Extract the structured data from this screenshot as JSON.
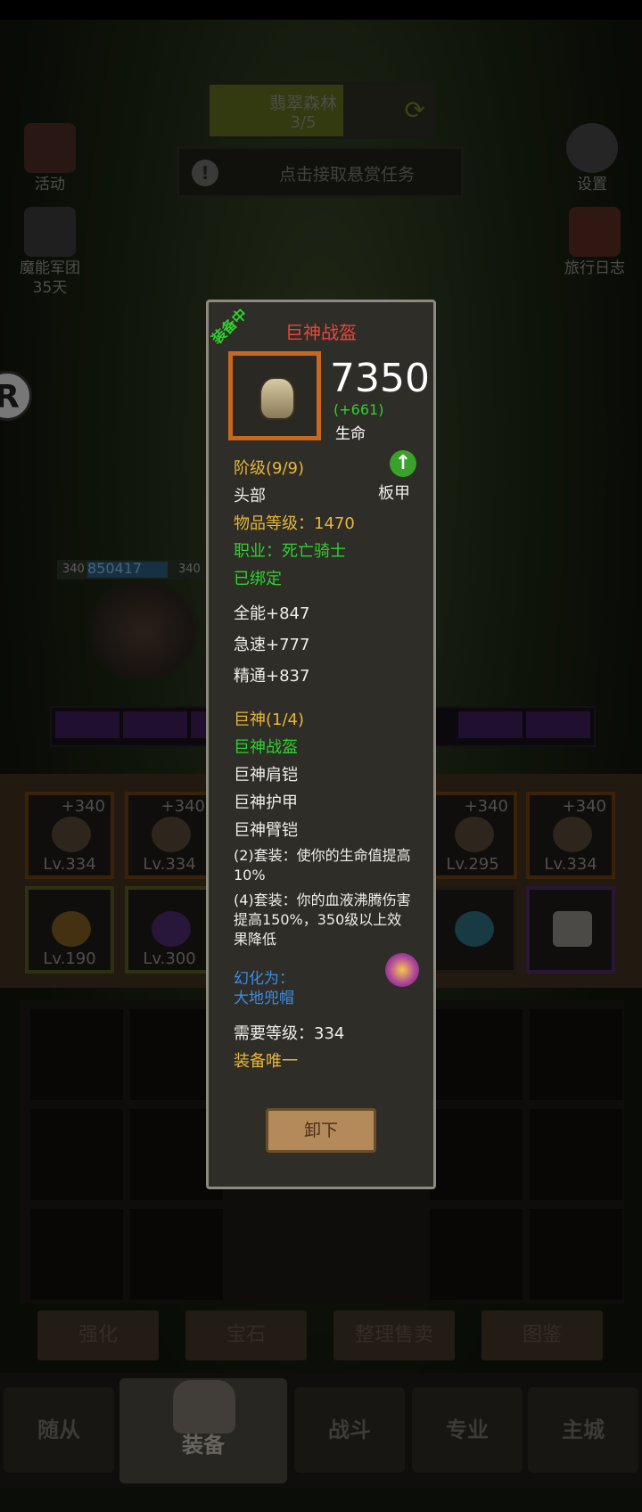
{
  "hud": {
    "stage_name": "翡翠森林",
    "stage_progress": "3/5",
    "bounty_text": "点击接取悬赏任务",
    "left_icons": [
      {
        "label": "活动"
      },
      {
        "label": "魔能军团",
        "sub": "35天"
      }
    ],
    "right_icons": [
      {
        "label": "设置"
      },
      {
        "label": "旅行日志"
      }
    ]
  },
  "battle": {
    "hero_level_left": "340",
    "hero_power": "850417",
    "hero_level_right": "340"
  },
  "equip_slots_top": [
    {
      "plus": "+340",
      "level": "Lv.334"
    },
    {
      "plus": "+340",
      "level": "Lv.334"
    },
    {
      "plus": "+340",
      "level": "Lv.295"
    },
    {
      "plus": "+340",
      "level": "Lv.334"
    }
  ],
  "equip_slots_bottom": [
    {
      "level": "Lv.190"
    },
    {
      "level": "Lv.300"
    }
  ],
  "sub_buttons": [
    "强化",
    "宝石",
    "整理售卖",
    "图鉴"
  ],
  "bottom_nav": [
    "随从",
    "装备",
    "战斗",
    "专业",
    "主城"
  ],
  "tooltip": {
    "equipped_tag": "装备中",
    "item_name": "巨神战盔",
    "main_stat_value": "7350",
    "main_stat_delta": "(+661)",
    "main_stat_name": "生命",
    "tier": "阶级(9/9)",
    "slot": "头部",
    "armor_type": "板甲",
    "item_level": "物品等级：1470",
    "class_req": "职业：死亡骑士",
    "bound": "已绑定",
    "stats": [
      "全能+847",
      "急速+777",
      "精通+837"
    ],
    "set_name": "巨神(1/4)",
    "set_pieces": [
      {
        "name": "巨神战盔",
        "owned": true
      },
      {
        "name": "巨神肩铠",
        "owned": false
      },
      {
        "name": "巨神护甲",
        "owned": false
      },
      {
        "name": "巨神臂铠",
        "owned": false
      }
    ],
    "set_bonus_2": "(2)套装：使你的生命值提高10%",
    "set_bonus_4": "(4)套装：你的血液沸腾伤害提高150%，350级以上效果降低",
    "transmog_label": "幻化为：",
    "transmog_item": "大地兜帽",
    "required_level": "需要等级：334",
    "unique": "装备唯一",
    "unequip_button": "卸下"
  },
  "colors": {
    "legendary_title": "#e8473c",
    "green_text": "#2fd12f",
    "gold_text": "#e8b63a",
    "blue_text": "#3c8de6"
  }
}
